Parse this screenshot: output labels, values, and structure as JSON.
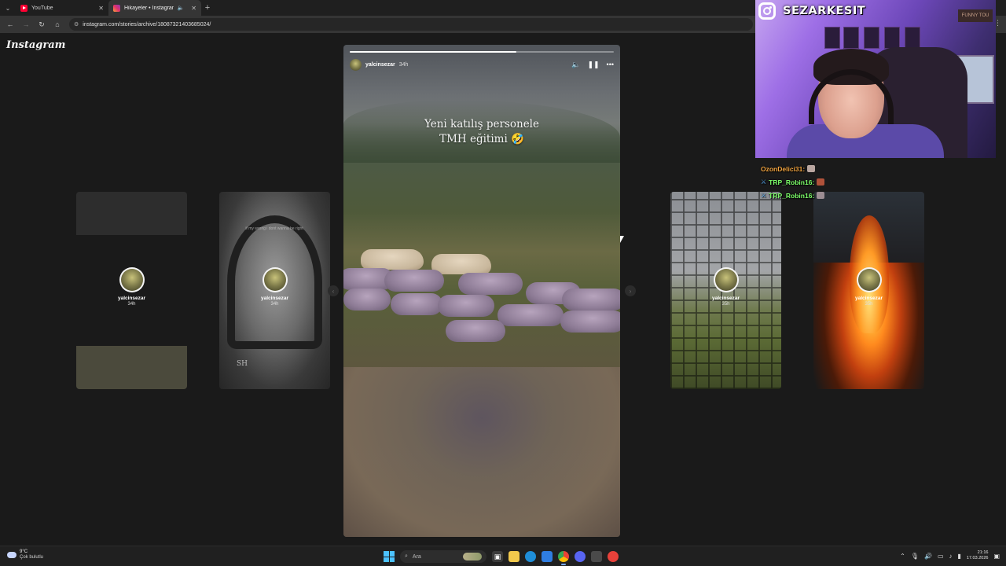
{
  "browser": {
    "tabs": [
      {
        "title": "YouTube",
        "icon": "youtube-icon",
        "active": false
      },
      {
        "title": "Hikayeler • Instagram",
        "icon": "instagram-icon",
        "active": true
      }
    ],
    "new_tab_label": "+",
    "url": "instagram.com/stories/archive/18087321403685024/"
  },
  "instagram": {
    "logo": "Instagram",
    "side_stories": [
      {
        "username": "yalcinsezar",
        "age": "34h"
      },
      {
        "username": "yalcinsezar",
        "age": "34h"
      },
      {
        "username": "yalcinsezar",
        "age": "35h"
      },
      {
        "username": "yalcinsezar",
        "age": "35h"
      }
    ],
    "story_card_text": "if my wrong i dont wanna be right",
    "story_card_sig": "SH",
    "active_story": {
      "username": "yalcinsezar",
      "age": "34h",
      "caption_line1": "Yeni katılış personele",
      "caption_line2": "TMH eğitimi 🤣",
      "progress": 0.63
    }
  },
  "stream_overlay": {
    "handle": "SEZARKESIT",
    "sign_text": "FUNNY TOU",
    "chat": [
      {
        "user": "OzonDelici31:",
        "color": "#f2a541",
        "badge": false,
        "emote_color": "#b9a6a0"
      },
      {
        "user": "TRP_Robin16:",
        "color": "#7dff6a",
        "badge": true,
        "emote_color": "#b0523a"
      },
      {
        "user": "TRP_Robin16:",
        "color": "#7dff6a",
        "badge": true,
        "emote_color": "#9c8d93"
      }
    ]
  },
  "taskbar": {
    "temperature": "9°C",
    "weather": "Çok bulutlu",
    "search_placeholder": "Ara",
    "time": "21:16",
    "date": "17.03.2026"
  },
  "colors": {
    "page_bg": "#1a1a1a",
    "accent_windows": "#4cc2ff",
    "overlay_purple": "#9e6fe6"
  }
}
